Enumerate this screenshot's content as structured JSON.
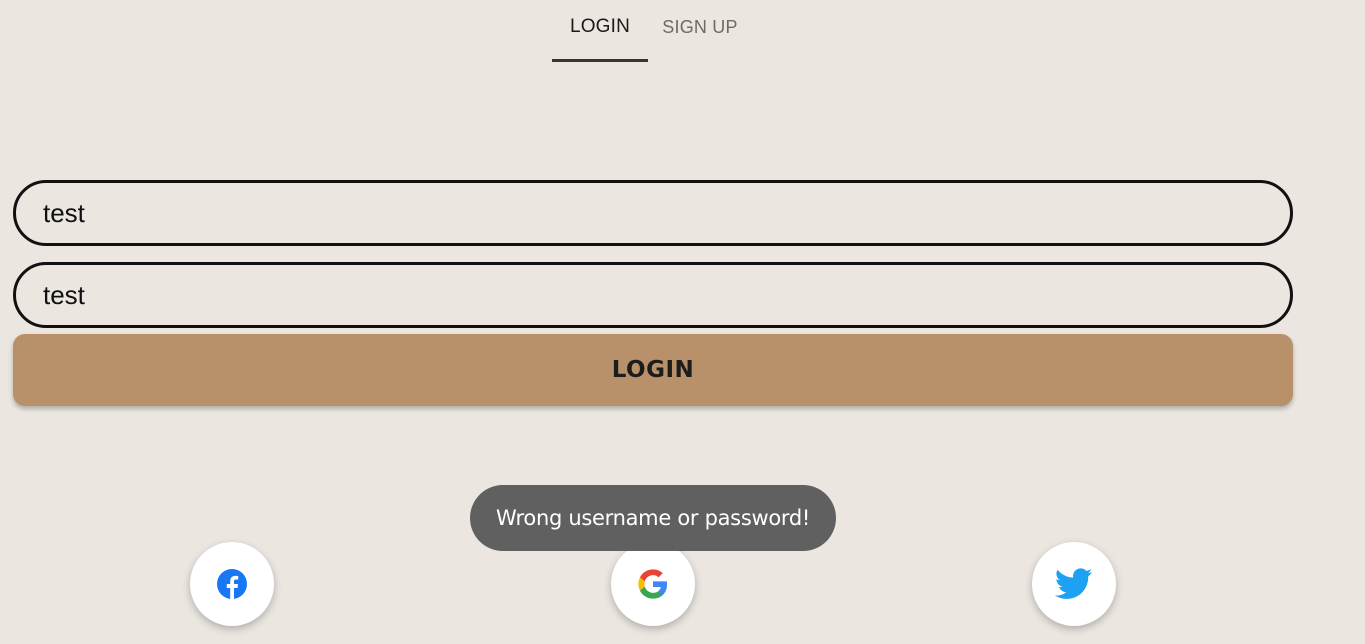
{
  "tabs": {
    "login_label": "LOGIN",
    "signup_label": "SIGN UP",
    "active": "LOGIN"
  },
  "form": {
    "username_value": "test",
    "password_value": "test",
    "submit_label": "LOGIN"
  },
  "toast": {
    "message": "Wrong username or password!"
  },
  "social": {
    "facebook_icon": "facebook-icon",
    "google_icon": "google-icon",
    "twitter_icon": "twitter-icon"
  },
  "colors": {
    "background": "#ebe6e0",
    "accent": "#b8916b",
    "toast_background": "#606060",
    "facebook": "#1877f2",
    "twitter": "#1da1f2"
  }
}
